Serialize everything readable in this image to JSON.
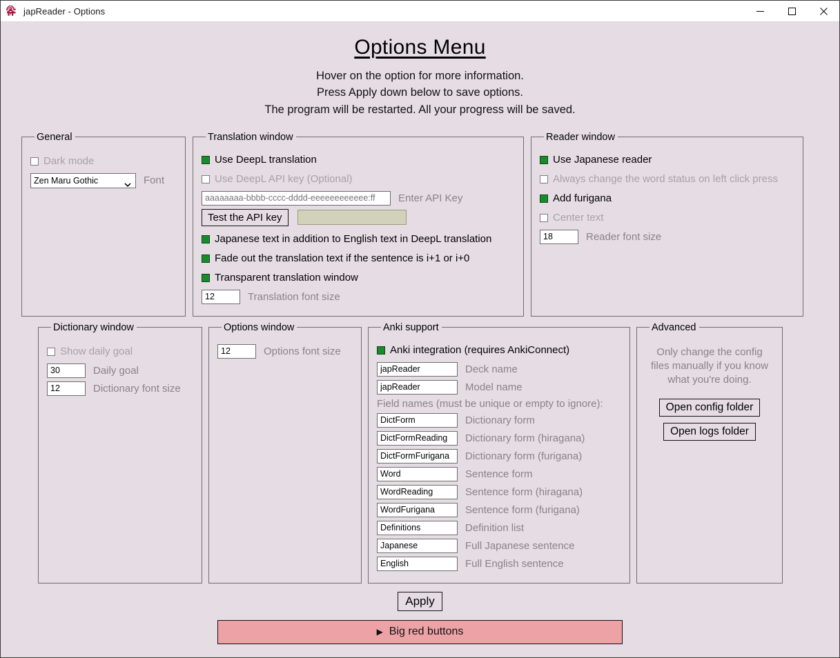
{
  "window": {
    "title": "japReader - Options",
    "icon": "app-icon",
    "minimize": "—",
    "maximize": "□",
    "close": "✕",
    "background_color": "#e6dde4",
    "accent_checked_color": "#1b8a2d",
    "big_red_color": "#eda3a6"
  },
  "header": {
    "title": "Options Menu",
    "line1": "Hover on the option for more information.",
    "line2": "Press Apply down below to save options.",
    "line3": "The program will be restarted. All your progress will be saved."
  },
  "general": {
    "legend": "General",
    "dark_mode": {
      "label": "Dark mode",
      "checked": false
    },
    "font": {
      "value": "Zen Maru Gothic",
      "label": "Font",
      "options": [
        "Zen Maru Gothic"
      ]
    }
  },
  "translation": {
    "legend": "Translation window",
    "use_deepl": {
      "label": "Use DeepL translation",
      "checked": true
    },
    "use_api_key": {
      "label": "Use DeepL API key (Optional)",
      "checked": false
    },
    "api_key": {
      "placeholder": "aaaaaaaa-bbbb-cccc-dddd-eeeeeeeeeeee:ff",
      "value": "",
      "label": "Enter API Key"
    },
    "test_button": "Test the API key",
    "test_result": "",
    "japanese_text": {
      "label": "Japanese text in addition to English text in DeepL translation",
      "checked": true
    },
    "fade_out": {
      "label": "Fade out the translation text if the sentence is i+1 or i+0",
      "checked": true
    },
    "transparent": {
      "label": "Transparent translation window",
      "checked": true
    },
    "font_size": {
      "value": "12",
      "label": "Translation font size"
    }
  },
  "reader": {
    "legend": "Reader window",
    "use_reader": {
      "label": "Use Japanese reader",
      "checked": true
    },
    "always_change": {
      "label": "Always change the word status on left click press",
      "checked": false
    },
    "add_furigana": {
      "label": "Add furigana",
      "checked": true
    },
    "center_text": {
      "label": "Center text",
      "checked": false
    },
    "font_size": {
      "value": "18",
      "label": "Reader font size"
    }
  },
  "dictionary": {
    "legend": "Dictionary window",
    "show_daily_goal": {
      "label": "Show daily goal",
      "checked": false
    },
    "daily_goal": {
      "value": "30",
      "label": "Daily goal"
    },
    "font_size": {
      "value": "12",
      "label": "Dictionary font size"
    }
  },
  "options_window": {
    "legend": "Options window",
    "font_size": {
      "value": "12",
      "label": "Options font size"
    }
  },
  "anki": {
    "legend": "Anki support",
    "integration": {
      "label": "Anki integration (requires AnkiConnect)",
      "checked": true
    },
    "deck_name": {
      "value": "japReader",
      "label": "Deck name"
    },
    "model_name": {
      "value": "japReader",
      "label": "Model name"
    },
    "fields_note": "Field names (must be unique or empty to ignore):",
    "fields": [
      {
        "value": "DictForm",
        "label": "Dictionary form"
      },
      {
        "value": "DictFormReading",
        "label": "Dictionary form (hiragana)"
      },
      {
        "value": "DictFormFurigana",
        "label": "Dictionary form (furigana)"
      },
      {
        "value": "Word",
        "label": "Sentence form"
      },
      {
        "value": "WordReading",
        "label": "Sentence form (hiragana)"
      },
      {
        "value": "WordFurigana",
        "label": "Sentence form (furigana)"
      },
      {
        "value": "Definitions",
        "label": "Definition list"
      },
      {
        "value": "Japanese",
        "label": "Full Japanese sentence"
      },
      {
        "value": "English",
        "label": "Full English sentence"
      }
    ]
  },
  "advanced": {
    "legend": "Advanced",
    "note": "Only change the config files manually if you know what you're doing.",
    "open_config": "Open config folder",
    "open_logs": "Open logs folder"
  },
  "footer": {
    "apply": "Apply",
    "big_red": "Big red buttons",
    "big_red_arrow": "▶"
  }
}
